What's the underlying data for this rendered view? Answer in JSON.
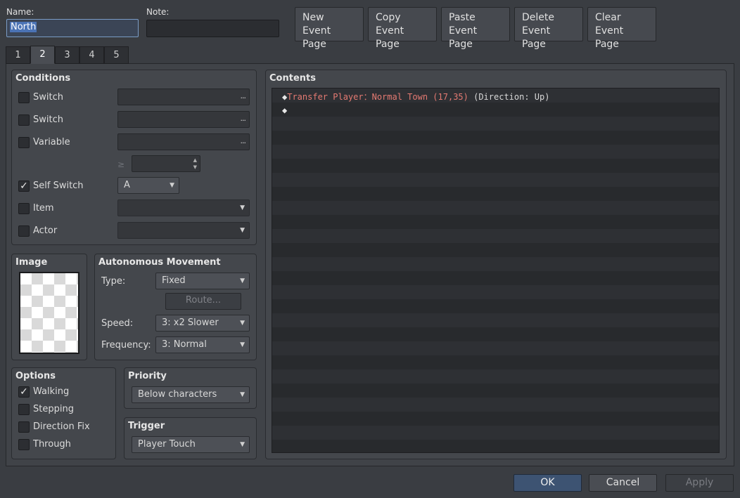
{
  "header": {
    "name_label": "Name:",
    "name_value": "North",
    "note_label": "Note:",
    "note_value": "",
    "buttons": [
      {
        "line1": "New",
        "line2": "Event Page"
      },
      {
        "line1": "Copy",
        "line2": "Event Page"
      },
      {
        "line1": "Paste",
        "line2": "Event Page"
      },
      {
        "line1": "Delete",
        "line2": "Event Page"
      },
      {
        "line1": "Clear",
        "line2": "Event Page"
      }
    ]
  },
  "tabs": [
    {
      "label": "1",
      "active": false
    },
    {
      "label": "2",
      "active": true
    },
    {
      "label": "3",
      "active": false
    },
    {
      "label": "4",
      "active": false
    },
    {
      "label": "5",
      "active": false
    }
  ],
  "conditions": {
    "title": "Conditions",
    "rows": [
      {
        "label": "Switch",
        "checked": false,
        "checkmark": ""
      },
      {
        "label": "Switch",
        "checked": false,
        "checkmark": ""
      },
      {
        "label": "Variable",
        "checked": false,
        "checkmark": ""
      },
      {
        "label": "Self Switch",
        "checked": true,
        "checkmark": "✓",
        "value": "A"
      },
      {
        "label": "Item",
        "checked": false,
        "checkmark": ""
      },
      {
        "label": "Actor",
        "checked": false,
        "checkmark": ""
      }
    ],
    "dots": "...",
    "gte_symbol": "≥"
  },
  "image": {
    "title": "Image"
  },
  "movement": {
    "title": "Autonomous Movement",
    "type_label": "Type:",
    "type_value": "Fixed",
    "route_label": "Route...",
    "speed_label": "Speed:",
    "speed_value": "3: x2 Slower",
    "frequency_label": "Frequency:",
    "frequency_value": "3: Normal"
  },
  "options": {
    "title": "Options",
    "items": [
      {
        "label": "Walking",
        "checked": true,
        "checkmark": "✓"
      },
      {
        "label": "Stepping",
        "checked": false,
        "checkmark": ""
      },
      {
        "label": "Direction Fix",
        "checked": false,
        "checkmark": ""
      },
      {
        "label": "Through",
        "checked": false,
        "checkmark": ""
      }
    ]
  },
  "priority": {
    "title": "Priority",
    "value": "Below characters"
  },
  "trigger": {
    "title": "Trigger",
    "value": "Player Touch"
  },
  "contents": {
    "title": "Contents",
    "commands": [
      {
        "marker": "◆",
        "command": "Transfer Player：Normal Town (17,35)",
        "params": " (Direction: Up)"
      },
      {
        "marker": "◆",
        "command": "",
        "params": ""
      }
    ]
  },
  "footer": {
    "ok": "OK",
    "cancel": "Cancel",
    "apply": "Apply"
  },
  "icons": {
    "dropdown": "▼",
    "spin_up": "▲",
    "spin_down": "▼"
  },
  "colors": {
    "background": "#3a3d42",
    "command_text": "#e57a72",
    "ok_button": "#3d5372"
  }
}
